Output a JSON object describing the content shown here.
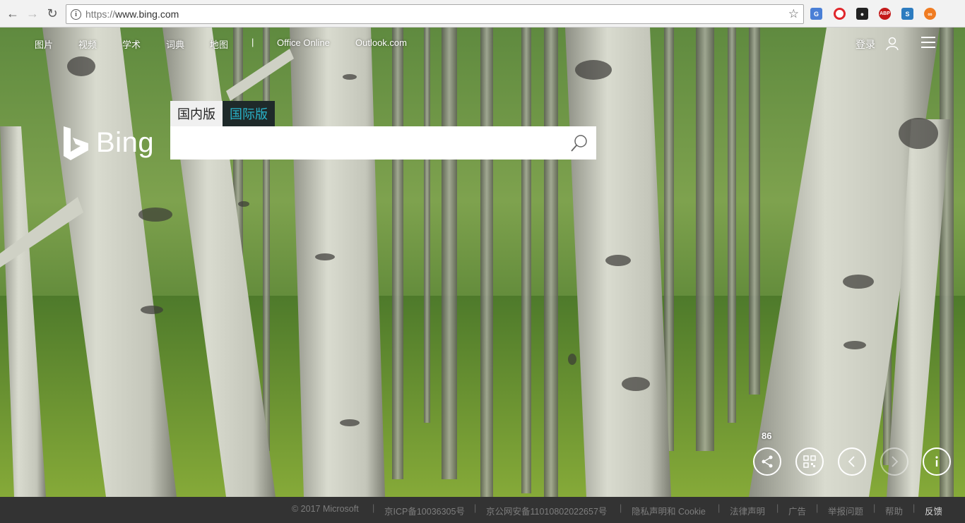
{
  "browser": {
    "url_proto": "https://",
    "url_host": "www.bing.com"
  },
  "topnav": {
    "items": [
      "图片",
      "视频",
      "学术",
      "词典",
      "地图"
    ],
    "separator": "|",
    "office": "Office Online",
    "outlook": "Outlook.com",
    "login": "登录"
  },
  "logo_text": "Bing",
  "tabs": {
    "domestic": "国内版",
    "international": "国际版"
  },
  "search": {
    "value": ""
  },
  "image_count": "86",
  "footer": {
    "items": [
      "© 2017 Microsoft",
      "京ICP备10036305号",
      "京公网安备11010802022657号",
      "隐私声明和 Cookie",
      "法律声明",
      "广告",
      "举报问题",
      "帮助",
      "反馈"
    ]
  },
  "colors": {
    "accent_intl": "#29b3c9",
    "footer_bg": "#333333"
  }
}
